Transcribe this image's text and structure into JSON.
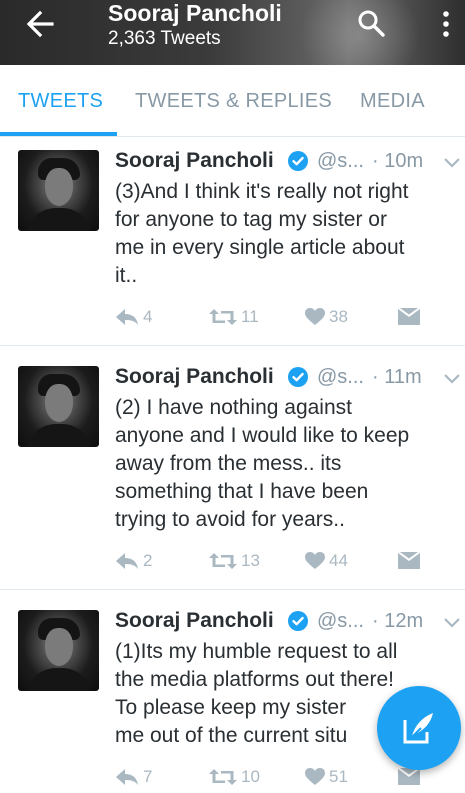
{
  "header": {
    "title": "Sooraj Pancholi",
    "subtitle": "2,363 Tweets"
  },
  "tabs": [
    {
      "label": "TWEETS",
      "active": true
    },
    {
      "label": "TWEETS & REPLIES",
      "active": false
    },
    {
      "label": "MEDIA",
      "active": false
    }
  ],
  "tweets": [
    {
      "name": "Sooraj Pancholi",
      "handle": "@s...",
      "time": "· 10m",
      "lines": [
        "(3)And I think it's really not right",
        "for anyone to tag my sister or",
        "me in every single article about",
        "it.."
      ],
      "replies": "4",
      "retweets": "11",
      "likes": "38"
    },
    {
      "name": "Sooraj Pancholi",
      "handle": "@s...",
      "time": "· 11m",
      "lines": [
        "(2) I have nothing against",
        "anyone and I would like to keep",
        "away from the mess.. its",
        "something that I have been",
        "trying to avoid for years.."
      ],
      "replies": "2",
      "retweets": "13",
      "likes": "44"
    },
    {
      "name": "Sooraj Pancholi",
      "handle": "@s...",
      "time": "· 12m",
      "lines": [
        "(1)Its my humble request to all",
        "the media platforms out there!",
        "To please keep my sister",
        "me out of the current situ"
      ],
      "replies": "7",
      "retweets": "10",
      "likes": "51"
    }
  ],
  "colors": {
    "accent": "#1da1f2",
    "muted": "#8899a6",
    "action": "#aab8c2"
  },
  "icons": {
    "back": "arrow-left-icon",
    "search": "search-icon",
    "more": "more-vertical-icon",
    "verified": "verified-badge-icon",
    "caret": "chevron-down-icon",
    "reply": "reply-icon",
    "retweet": "retweet-icon",
    "like": "heart-icon",
    "dm": "envelope-icon",
    "compose": "compose-tweet-icon"
  }
}
